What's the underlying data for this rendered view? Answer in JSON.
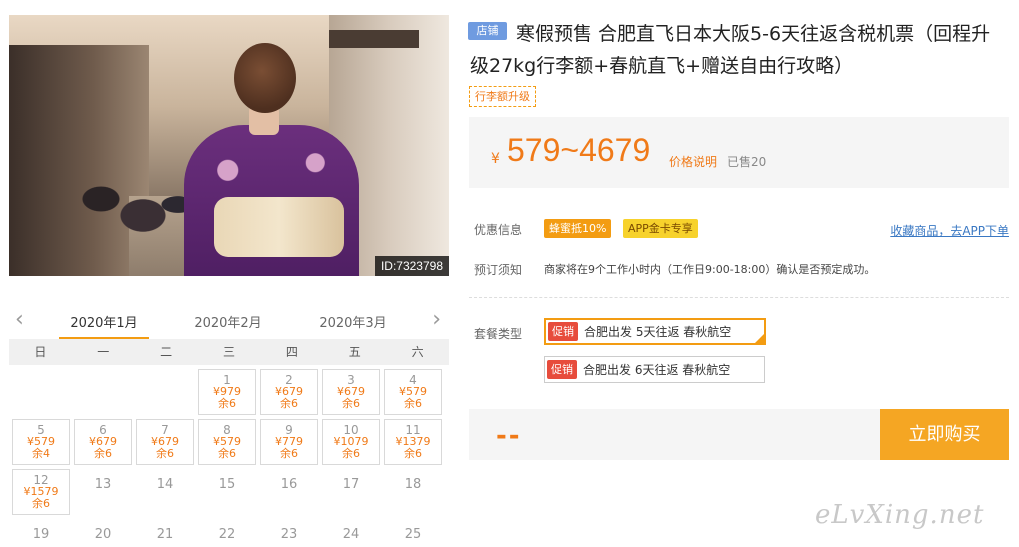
{
  "hero": {
    "image_id": "ID:7323798"
  },
  "calendar": {
    "months": [
      "2020年1月",
      "2020年2月",
      "2020年3月"
    ],
    "weekdays": [
      "日",
      "一",
      "二",
      "三",
      "四",
      "五",
      "六"
    ],
    "days": [
      {
        "day": "1",
        "price": "¥979",
        "stock": "余6"
      },
      {
        "day": "2",
        "price": "¥679",
        "stock": "余6"
      },
      {
        "day": "3",
        "price": "¥679",
        "stock": "余6"
      },
      {
        "day": "4",
        "price": "¥579",
        "stock": "余6"
      },
      {
        "day": "5",
        "price": "¥579",
        "stock": "余4"
      },
      {
        "day": "6",
        "price": "¥679",
        "stock": "余6"
      },
      {
        "day": "7",
        "price": "¥679",
        "stock": "余6"
      },
      {
        "day": "8",
        "price": "¥579",
        "stock": "余6"
      },
      {
        "day": "9",
        "price": "¥779",
        "stock": "余6"
      },
      {
        "day": "10",
        "price": "¥1079",
        "stock": "余6"
      },
      {
        "day": "11",
        "price": "¥1379",
        "stock": "余6"
      },
      {
        "day": "12",
        "price": "¥1579",
        "stock": "余6"
      },
      {
        "day": "13"
      },
      {
        "day": "14"
      },
      {
        "day": "15"
      },
      {
        "day": "16"
      },
      {
        "day": "17"
      },
      {
        "day": "18"
      },
      {
        "day": "19"
      },
      {
        "day": "20"
      },
      {
        "day": "21"
      },
      {
        "day": "22"
      },
      {
        "day": "23"
      },
      {
        "day": "24"
      },
      {
        "day": "25"
      }
    ]
  },
  "product": {
    "shop_tag": "店铺",
    "title": "寒假预售 合肥直飞日本大阪5-6天往返含税机票（回程升级27kg行李额+春航直飞+赠送自由行攻略）",
    "feature_tag": "行李额升级",
    "price_currency": "¥",
    "price_range": "579~4679",
    "price_explain": "价格说明",
    "sold": "已售20"
  },
  "promo": {
    "label": "优惠信息",
    "badges": [
      "蜂蜜抵10%",
      "APP金卡专享"
    ],
    "fav_link": "收藏商品，去APP下单"
  },
  "notice": {
    "label": "预订须知",
    "text": "商家将在9个工作小时内（工作日9:00-18:00）确认是否预定成功。"
  },
  "package": {
    "label": "套餐类型",
    "options": [
      {
        "tag": "促销",
        "text": "合肥出发 5天往返 春秋航空"
      },
      {
        "tag": "促销",
        "text": "合肥出发 6天往返 春秋航空"
      }
    ]
  },
  "buy": {
    "price_placeholder": "--",
    "button": "立即购买"
  },
  "watermark": "eLvXing.net",
  "colors": {
    "accent": "#f39c12",
    "price": "#f07a18",
    "shop_tag": "#6f9be0",
    "link": "#3a78c3"
  }
}
